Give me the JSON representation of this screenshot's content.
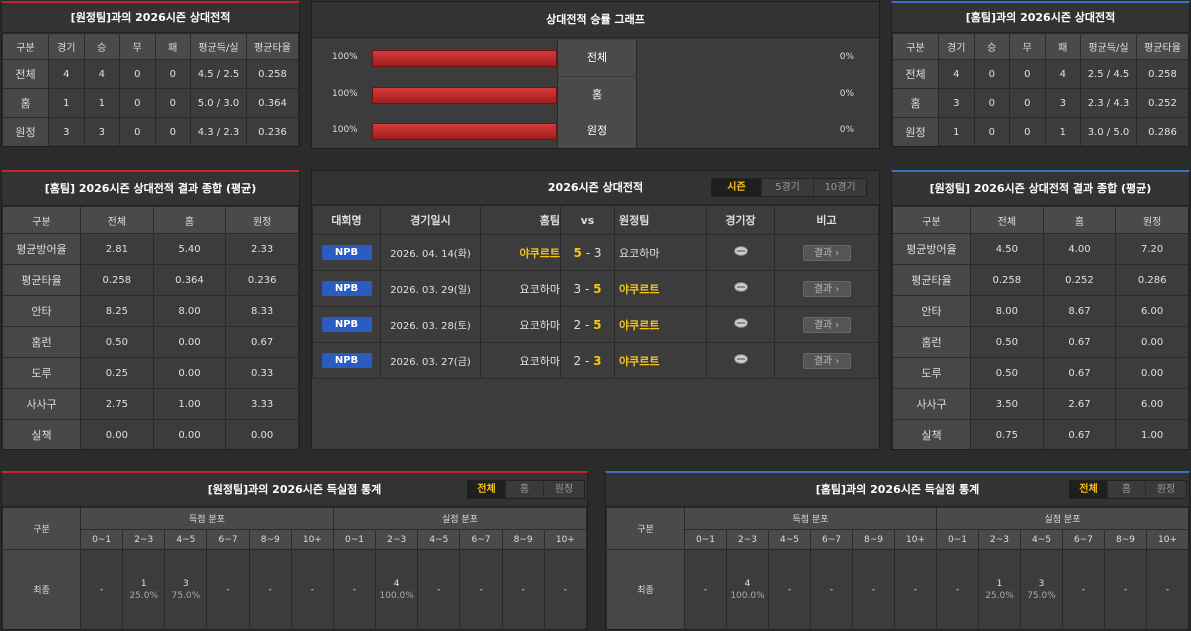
{
  "away_record": {
    "title": "[원정팀]과의 2026시즌 상대전적",
    "headers": [
      "구분",
      "경기",
      "승",
      "무",
      "패",
      "평균득/실",
      "평균타율"
    ],
    "rows": [
      [
        "전체",
        "4",
        "4",
        "0",
        "0",
        "4.5 / 2.5",
        "0.258"
      ],
      [
        "홈",
        "1",
        "1",
        "0",
        "0",
        "5.0 / 3.0",
        "0.364"
      ],
      [
        "원정",
        "3",
        "3",
        "0",
        "0",
        "4.3 / 2.3",
        "0.236"
      ]
    ]
  },
  "graph": {
    "title": "상대전적 승률 그래프",
    "rows": [
      {
        "left": "100%",
        "label": "전체",
        "right": "0%",
        "fill": 1.0
      },
      {
        "left": "100%",
        "label": "홈",
        "right": "0%",
        "fill": 1.0
      },
      {
        "left": "100%",
        "label": "원정",
        "right": "0%",
        "fill": 1.0
      }
    ]
  },
  "home_record": {
    "title": "[홈팀]과의 2026시즌 상대전적",
    "headers": [
      "구분",
      "경기",
      "승",
      "무",
      "패",
      "평균득/실",
      "평균타율"
    ],
    "rows": [
      [
        "전체",
        "4",
        "0",
        "0",
        "4",
        "2.5 / 4.5",
        "0.258"
      ],
      [
        "홈",
        "3",
        "0",
        "0",
        "3",
        "2.3 / 4.3",
        "0.252"
      ],
      [
        "원정",
        "1",
        "0",
        "0",
        "1",
        "3.0 / 5.0",
        "0.286"
      ]
    ]
  },
  "home_summary": {
    "title": "[홈팀] 2026시즌 상대전적 결과 종합 (평균)",
    "headers": [
      "구분",
      "전체",
      "홈",
      "원정"
    ],
    "rows": [
      [
        "평균방어율",
        "2.81",
        "5.40",
        "2.33"
      ],
      [
        "평균타율",
        "0.258",
        "0.364",
        "0.236"
      ],
      [
        "안타",
        "8.25",
        "8.00",
        "8.33"
      ],
      [
        "홈런",
        "0.50",
        "0.00",
        "0.67"
      ],
      [
        "도루",
        "0.25",
        "0.00",
        "0.33"
      ],
      [
        "사사구",
        "2.75",
        "1.00",
        "3.33"
      ],
      [
        "실책",
        "0.00",
        "0.00",
        "0.00"
      ]
    ]
  },
  "season": {
    "title": "2026시즌 상대전적",
    "tabs": [
      "시즌",
      "5경기",
      "10경기"
    ],
    "headers": {
      "league": "대회명",
      "date": "경기일시",
      "home": "홈팀",
      "vs": "vs",
      "away": "원정팀",
      "stadium": "경기장",
      "note": "비고"
    },
    "games": [
      {
        "league": "NPB",
        "date": "2026. 04. 14(화)",
        "home": "야쿠르트",
        "hs": "5",
        "as": "3",
        "away": "요코하마",
        "home_win": true,
        "btn": "결과"
      },
      {
        "league": "NPB",
        "date": "2026. 03. 29(일)",
        "home": "요코하마",
        "hs": "3",
        "as": "5",
        "away": "야쿠르트",
        "home_win": false,
        "btn": "결과"
      },
      {
        "league": "NPB",
        "date": "2026. 03. 28(토)",
        "home": "요코하마",
        "hs": "2",
        "as": "5",
        "away": "야쿠르트",
        "home_win": false,
        "btn": "결과"
      },
      {
        "league": "NPB",
        "date": "2026. 03. 27(금)",
        "home": "요코하마",
        "hs": "2",
        "as": "3",
        "away": "야쿠르트",
        "home_win": false,
        "btn": "결과"
      }
    ]
  },
  "away_summary": {
    "title": "[원정팀] 2026시즌 상대전적 결과 종합 (평균)",
    "headers": [
      "구분",
      "전체",
      "홈",
      "원정"
    ],
    "rows": [
      [
        "평균방어율",
        "4.50",
        "4.00",
        "7.20"
      ],
      [
        "평균타율",
        "0.258",
        "0.252",
        "0.286"
      ],
      [
        "안타",
        "8.00",
        "8.67",
        "6.00"
      ],
      [
        "홈런",
        "0.50",
        "0.67",
        "0.00"
      ],
      [
        "도루",
        "0.50",
        "0.67",
        "0.00"
      ],
      [
        "사사구",
        "3.50",
        "2.67",
        "6.00"
      ],
      [
        "실책",
        "0.75",
        "0.67",
        "1.00"
      ]
    ]
  },
  "away_dist": {
    "title": "[원정팀]과의 2026시즌 득실점 통계",
    "tabs": [
      "전체",
      "홈",
      "원정"
    ],
    "col_label": "구분",
    "scored_label": "득점 분포",
    "allowed_label": "실점 분포",
    "bins": [
      "0~1",
      "2~3",
      "4~5",
      "6~7",
      "8~9",
      "10+"
    ],
    "row_label": "최종",
    "scored": [
      [
        "-",
        ""
      ],
      [
        "1",
        "25.0%"
      ],
      [
        "3",
        "75.0%"
      ],
      [
        "-",
        ""
      ],
      [
        "-",
        ""
      ],
      [
        "-",
        ""
      ]
    ],
    "allowed": [
      [
        "-",
        ""
      ],
      [
        "4",
        "100.0%"
      ],
      [
        "-",
        ""
      ],
      [
        "-",
        ""
      ],
      [
        "-",
        ""
      ],
      [
        "-",
        ""
      ]
    ]
  },
  "home_dist": {
    "title": "[홈팀]과의 2026시즌 득실점 통계",
    "tabs": [
      "전체",
      "홈",
      "원정"
    ],
    "col_label": "구분",
    "scored_label": "득점 분포",
    "allowed_label": "실점 분포",
    "bins": [
      "0~1",
      "2~3",
      "4~5",
      "6~7",
      "8~9",
      "10+"
    ],
    "row_label": "최종",
    "scored": [
      [
        "-",
        ""
      ],
      [
        "4",
        "100.0%"
      ],
      [
        "-",
        ""
      ],
      [
        "-",
        ""
      ],
      [
        "-",
        ""
      ],
      [
        "-",
        ""
      ]
    ],
    "allowed": [
      [
        "-",
        ""
      ],
      [
        "1",
        "25.0%"
      ],
      [
        "3",
        "75.0%"
      ],
      [
        "-",
        ""
      ],
      [
        "-",
        ""
      ],
      [
        "-",
        ""
      ]
    ]
  }
}
